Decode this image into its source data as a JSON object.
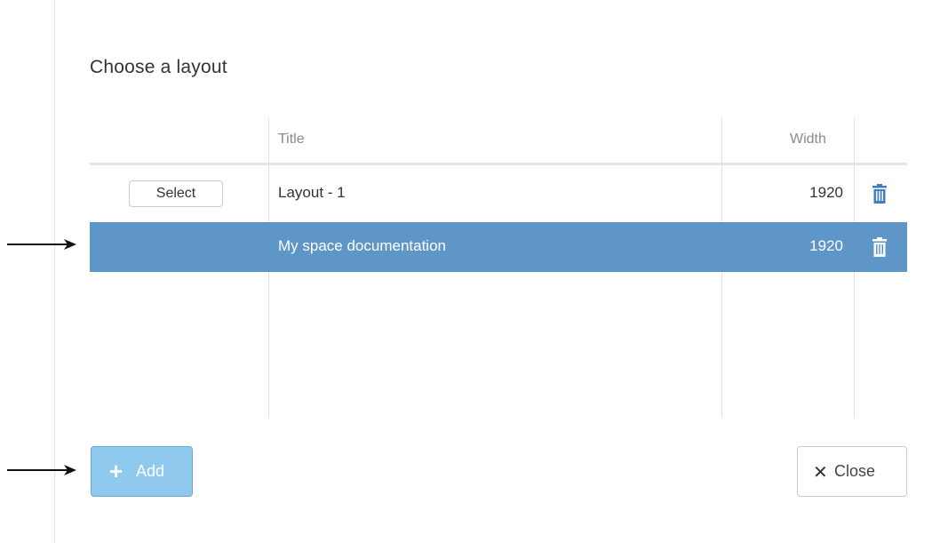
{
  "dialog": {
    "title": "Choose a layout"
  },
  "table": {
    "columns": {
      "title": "Title",
      "width": "Width"
    },
    "rows": [
      {
        "select_label": "Select",
        "title": "Layout - 1",
        "width": "1920",
        "selected": false
      },
      {
        "title": "My space documentation",
        "width": "1920",
        "selected": true
      }
    ]
  },
  "buttons": {
    "add_icon": "plus-icon",
    "add_label": "Add",
    "close_icon": "close-icon",
    "close_label": "Close"
  },
  "colors": {
    "selected_row": "#5f96c8",
    "add_button": "#8fc9ee",
    "trash_icon": "#3f7fbf"
  }
}
